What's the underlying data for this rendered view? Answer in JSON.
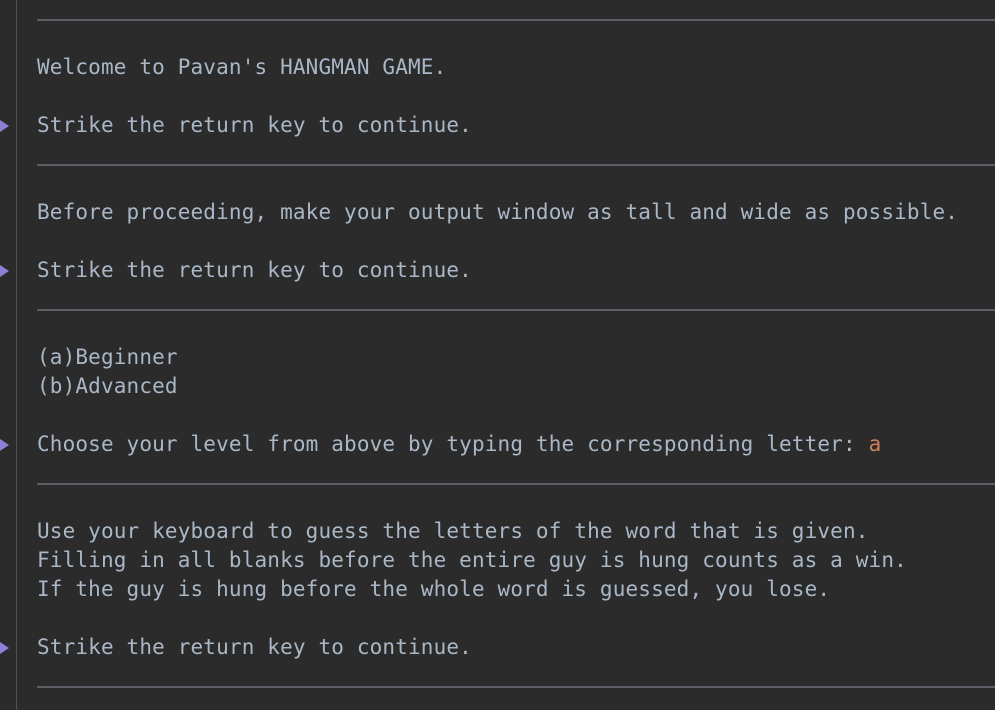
{
  "console": {
    "welcome": "Welcome to Pavan's HANGMAN GAME.",
    "prompt_continue_1": "Strike the return key to continue.",
    "instruction_window": "Before proceeding, make your output window as tall and wide as possible.",
    "prompt_continue_2": "Strike the return key to continue.",
    "option_a": "(a)Beginner",
    "option_b": "(b)Advanced",
    "level_prompt": "Choose your level from above by typing the corresponding letter: ",
    "level_input": "a",
    "rules_line_1": "Use your keyboard to guess the letters of the word that is given.",
    "rules_line_2": "Filling in all blanks before the entire guy is hung counts as a win.",
    "rules_line_3": "If the guy is hung before the whole word is guessed, you lose.",
    "prompt_continue_3": "Strike the return key to continue."
  },
  "colors": {
    "background": "#2b2b2b",
    "text": "#a9b7c6",
    "input": "#cc7f5a",
    "arrow": "#8f7fd6",
    "rule": "#5a6066"
  }
}
